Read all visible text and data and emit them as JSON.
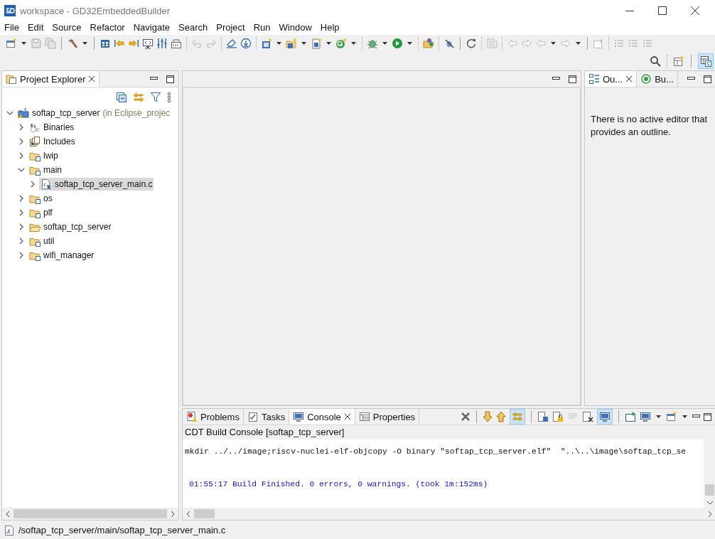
{
  "window": {
    "title": "workspace - GD32EmbeddedBuilder"
  },
  "menu": [
    "File",
    "Edit",
    "Source",
    "Refactor",
    "Navigate",
    "Search",
    "Project",
    "Run",
    "Window",
    "Help"
  ],
  "project_explorer": {
    "tab": {
      "label": "Project Explorer",
      "selected": true
    },
    "tree": [
      {
        "label": "softap_tcp_server",
        "annotation": "(in Eclipse_projec",
        "kind": "project",
        "expanded": true,
        "selected": false,
        "children": [
          {
            "label": "Binaries",
            "kind": "binaries",
            "expanded": false,
            "selected": false
          },
          {
            "label": "Includes",
            "kind": "includes",
            "expanded": false,
            "selected": false
          },
          {
            "label": "lwip",
            "kind": "source-folder",
            "expanded": false,
            "selected": false
          },
          {
            "label": "main",
            "kind": "source-folder",
            "expanded": true,
            "selected": false,
            "children": [
              {
                "label": "softap_tcp_server_main.c",
                "kind": "c-file",
                "expanded": false,
                "selected": true
              }
            ]
          },
          {
            "label": "os",
            "kind": "source-folder",
            "expanded": false,
            "selected": false
          },
          {
            "label": "plf",
            "kind": "source-folder",
            "expanded": false,
            "selected": false
          },
          {
            "label": "softap_tcp_server",
            "kind": "folder",
            "expanded": false,
            "selected": false
          },
          {
            "label": "util",
            "kind": "source-folder",
            "expanded": false,
            "selected": false
          },
          {
            "label": "wifi_manager",
            "kind": "source-folder",
            "expanded": false,
            "selected": false
          }
        ]
      }
    ]
  },
  "outline": {
    "tabs": [
      {
        "label": "Ou...",
        "kind": "outline",
        "selected": true
      },
      {
        "label": "Bu...",
        "kind": "build",
        "selected": false
      }
    ],
    "message": "There is no active editor that provides an outline."
  },
  "console": {
    "tabs": [
      {
        "label": "Problems",
        "kind": "problems",
        "selected": false
      },
      {
        "label": "Tasks",
        "kind": "tasks",
        "selected": false
      },
      {
        "label": "Console",
        "kind": "console",
        "selected": true
      },
      {
        "label": "Properties",
        "kind": "properties",
        "selected": false
      }
    ],
    "title": "CDT Build Console [softap_tcp_server]",
    "lines": [
      {
        "kind": "output",
        "text": "mkdir ../../image;riscv-nuclei-elf-objcopy -O binary \"softap_tcp_server.elf\"  \"..\\..\\image\\softap_tcp_se"
      },
      {
        "kind": "status",
        "text": "01:55:17 Build Finished. 0 errors, 0 warnings. (took 1m:152ms)"
      }
    ]
  },
  "status_bar": {
    "path": "/softap_tcp_server/main/softap_tcp_server_main.c"
  }
}
